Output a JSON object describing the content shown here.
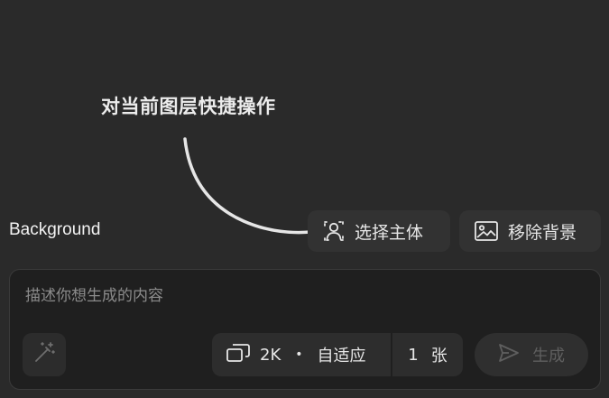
{
  "hint": {
    "title": "对当前图层快捷操作"
  },
  "layer": {
    "name": "Background"
  },
  "quick_actions": {
    "select_subject": "选择主体",
    "remove_background": "移除背景"
  },
  "composer": {
    "placeholder": "描述你想生成的内容",
    "value": "",
    "size": "2K",
    "separator": "•",
    "fit_mode": "自适应",
    "count": "1",
    "count_unit": "张",
    "generate_label": "生成",
    "generate_enabled": false
  },
  "icons": {
    "hint_arrow": "curved-arrow-icon",
    "select_subject": "person-select-icon",
    "remove_background": "image-icon",
    "magic": "magic-wand-icon",
    "aspect": "aspect-ratio-icon",
    "generate": "send-icon"
  },
  "colors": {
    "background": "#2a2a2a",
    "button": "#323232",
    "composer": "#1f1f1f",
    "disabled_text": "#5f5f5f"
  }
}
